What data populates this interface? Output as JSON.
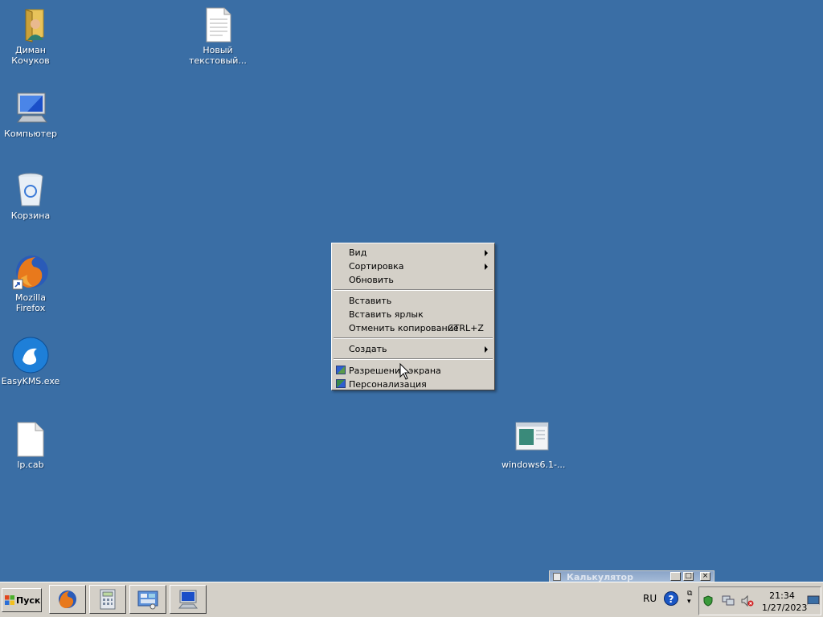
{
  "desktop": {
    "icons": [
      {
        "label": "Диман Кочуков",
        "icon": "user-folder-icon"
      },
      {
        "label": "Новый текстовый...",
        "icon": "text-file-icon"
      },
      {
        "label": "Компьютер",
        "icon": "computer-icon"
      },
      {
        "label": "Корзина",
        "icon": "recycle-bin-icon"
      },
      {
        "label": "Mozilla Firefox",
        "icon": "firefox-icon"
      },
      {
        "label": "EasyKMS.exe",
        "icon": "easykms-icon"
      },
      {
        "label": "lp.cab",
        "icon": "blank-file-icon"
      },
      {
        "label": "windows6.1-...",
        "icon": "update-package-icon"
      }
    ]
  },
  "context_menu": {
    "items": [
      {
        "label": "Вид",
        "submenu": true
      },
      {
        "label": "Сортировка",
        "submenu": true
      },
      {
        "label": "Обновить"
      },
      {
        "label": "Вставить"
      },
      {
        "label": "Вставить ярлык"
      },
      {
        "label": "Отменить копирование",
        "shortcut": "CTRL+Z"
      },
      {
        "label": "Создать",
        "submenu": true
      },
      {
        "label": "Разрешение экрана",
        "icon": "screen-resolution-icon"
      },
      {
        "label": "Персонализация",
        "icon": "personalization-icon"
      }
    ]
  },
  "taskbar": {
    "start_label": "Пуск",
    "quick_launch": [
      "firefox-icon",
      "calculator-icon",
      "control-panel-icon",
      "computer-icon"
    ],
    "language": "RU",
    "clock_time": "21:34",
    "clock_date": "1/27/2023"
  },
  "minimized_window": {
    "title": "Калькулятор"
  },
  "colors": {
    "desktop": "#3a6ea5",
    "chrome": "#d4d0c8"
  }
}
